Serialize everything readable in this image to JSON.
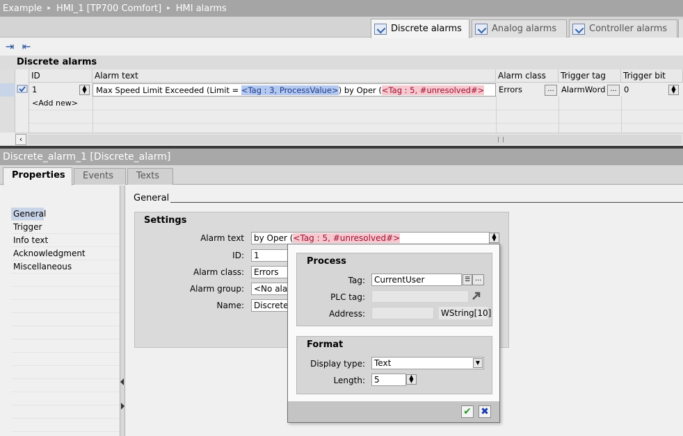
{
  "breadcrumb": {
    "items": [
      "Example",
      "HMI_1 [TP700 Comfort]",
      "HMI alarms"
    ],
    "separator": "▸"
  },
  "tabs": [
    {
      "label": "Discrete alarms",
      "icon": "discrete-alarm-icon"
    },
    {
      "label": "Analog alarms",
      "icon": "analog-alarm-icon"
    },
    {
      "label": "Controller alarms",
      "icon": "controller-alarm-icon"
    }
  ],
  "toolbar": {
    "btn1_icon": "⇥",
    "btn2_icon": "⇤"
  },
  "section_title": "Discrete alarms",
  "table": {
    "headers": [
      "ID",
      "Alarm text",
      "Alarm class",
      "Trigger tag",
      "Trigger bit"
    ],
    "row": {
      "id": "1",
      "text_pre": "Max Speed Limit Exceeded (Limit = ",
      "tag1": "<Tag : 3, ProcessValue>",
      "text_mid": ") by Oper (",
      "tag2": "<Tag : 5, #unresolved#>",
      "alarm_class": "Errors",
      "trigger_tag": "AlarmWord",
      "trigger_bit": "0",
      "dots": "..."
    },
    "add_new": "<Add new>"
  },
  "inspector": {
    "title": "Discrete_alarm_1 [Discrete_alarm]",
    "tabs": [
      "Properties",
      "Events",
      "Texts"
    ],
    "nav": [
      "General",
      "Trigger",
      "Info text",
      "Acknowledgment",
      "Miscellaneous"
    ],
    "general_label": "General",
    "settings": {
      "title": "Settings",
      "alarm_text_label": "Alarm text",
      "alarm_text_pre": "by Oper (",
      "alarm_text_tag": "<Tag : 5, #unresolved#>",
      "id_label": "ID:",
      "id_value": "1",
      "class_label": "Alarm class:",
      "class_value": "Errors",
      "group_label": "Alarm group:",
      "group_value": "<No alarm",
      "name_label": "Name:",
      "name_value": "Discrete_"
    }
  },
  "popup": {
    "process_title": "Process",
    "tag_label": "Tag:",
    "tag_value": "CurrentUser",
    "plc_label": "PLC tag:",
    "address_label": "Address:",
    "address_type": "WString[10]",
    "format_title": "Format",
    "display_label": "Display type:",
    "display_value": "Text",
    "length_label": "Length:",
    "length_value": "5"
  },
  "colors": {
    "tag_blue": "#b4c8f0",
    "tag_pink": "#f6c8d0",
    "ok_green": "#2a9a2a",
    "cancel_blue": "#1c3fb0"
  }
}
